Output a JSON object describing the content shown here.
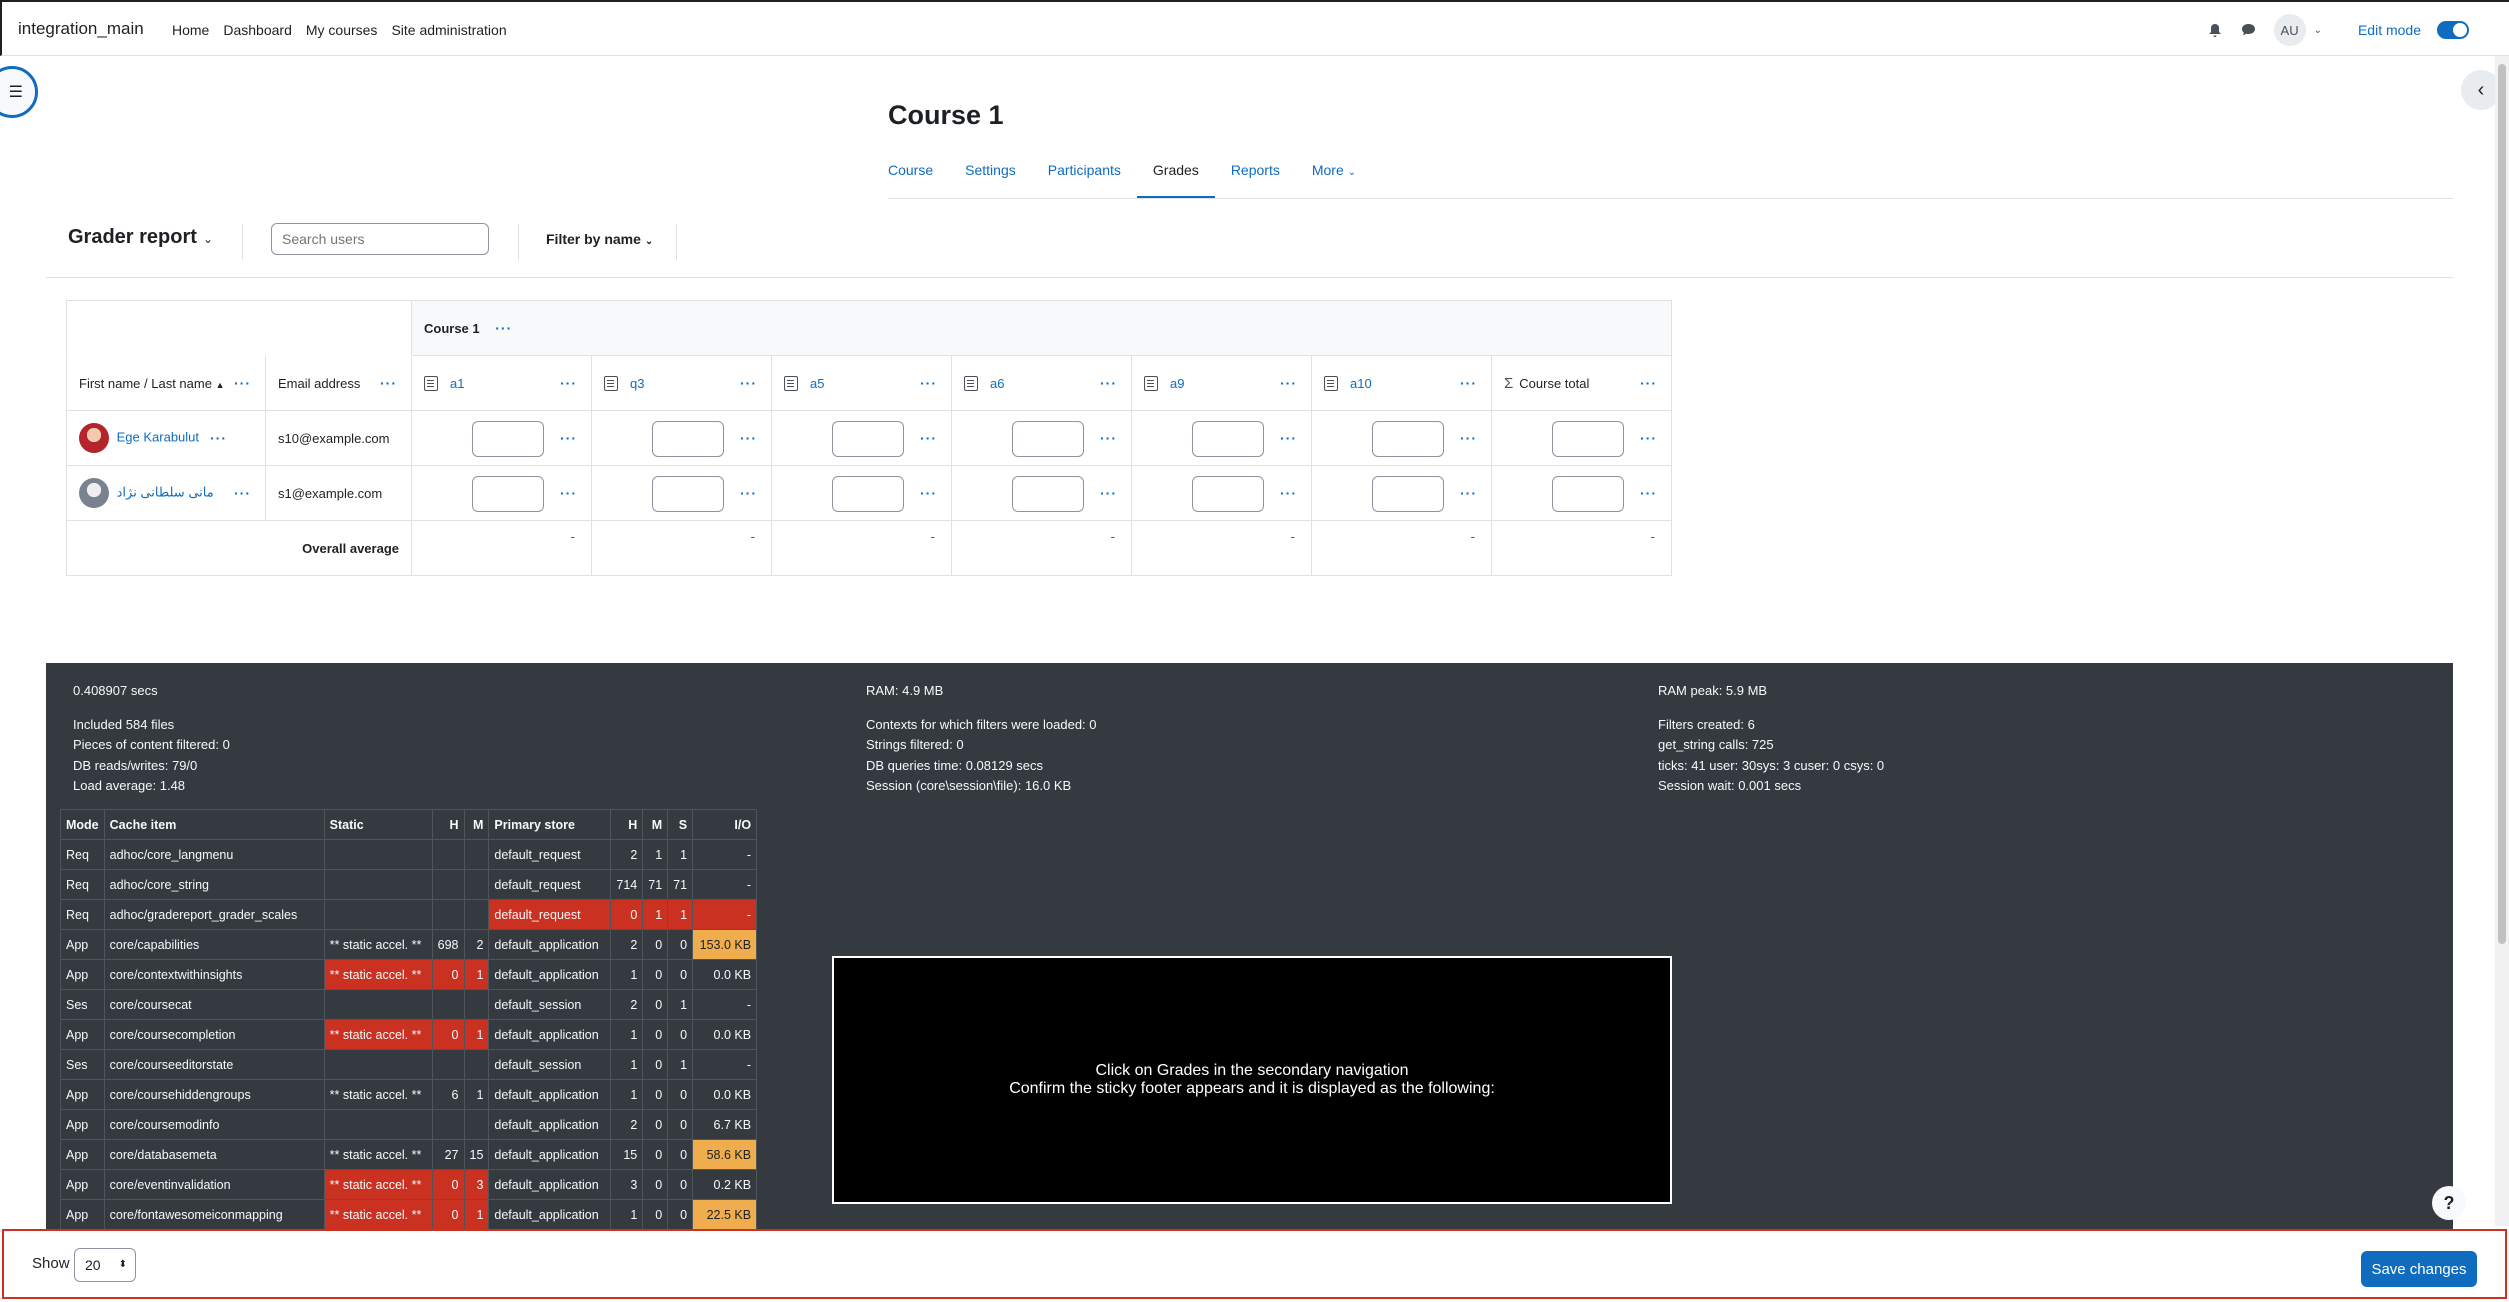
{
  "navbar": {
    "site_name": "integration_main",
    "links": [
      "Home",
      "Dashboard",
      "My courses",
      "Site administration"
    ],
    "user_initials": "AU",
    "edit_mode_label": "Edit mode"
  },
  "course": {
    "title": "Course 1",
    "tabs": [
      "Course",
      "Settings",
      "Participants",
      "Grades",
      "Reports",
      "More"
    ],
    "active_tab": "Grades"
  },
  "tertiary": {
    "report_title": "Grader report",
    "search_placeholder": "Search users",
    "filter_label": "Filter by name"
  },
  "grader": {
    "category": "Course 1",
    "name_header": "First name / Last name",
    "email_header": "Email address",
    "items": [
      "a1",
      "q3",
      "a5",
      "a6",
      "a9",
      "a10"
    ],
    "total_header": "Course total",
    "users": [
      {
        "name": "Ege Karabulut",
        "email": "s10@example.com"
      },
      {
        "name": "مانی سلطانی نژاد",
        "email": "s1@example.com"
      }
    ],
    "average_label": "Overall average",
    "average_values": [
      "-",
      "-",
      "-",
      "-",
      "-",
      "-",
      "-"
    ]
  },
  "perf": {
    "col1": [
      "0.408907 secs",
      "Included 584 files",
      "Pieces of content filtered: 0",
      "DB reads/writes: 79/0",
      "Load average: 1.48"
    ],
    "col2": [
      "RAM: 4.9 MB",
      "Contexts for which filters were loaded: 0",
      "Strings filtered: 0",
      "DB queries time: 0.08129 secs",
      "Session (core\\session\\file): 16.0 KB"
    ],
    "col3": [
      "RAM peak: 5.9 MB",
      "Filters created: 6",
      "get_string calls: 725",
      "ticks: 41 user: 30sys: 3 cuser: 0 csys: 0",
      "Session wait: 0.001 secs"
    ],
    "headers": [
      "Mode",
      "Cache item",
      "Static",
      "H",
      "M",
      "Primary store",
      "H",
      "M",
      "S",
      "I/O"
    ],
    "rows": [
      [
        "Req",
        "adhoc/core_langmenu",
        "",
        "",
        "",
        "default_request",
        "2",
        "1",
        "1",
        "-"
      ],
      [
        "Req",
        "adhoc/core_string",
        "",
        "",
        "",
        "default_request",
        "714",
        "71",
        "71",
        "-"
      ],
      [
        "Req",
        "adhoc/gradereport_grader_scales",
        "",
        "",
        "",
        "default_request",
        "0",
        "1",
        "1",
        "-"
      ],
      [
        "App",
        "core/capabilities",
        "** static accel. **",
        "698",
        "2",
        "default_application",
        "2",
        "0",
        "0",
        "153.0 KB"
      ],
      [
        "App",
        "core/contextwithinsights",
        "** static accel. **",
        "0",
        "1",
        "default_application",
        "1",
        "0",
        "0",
        "0.0 KB"
      ],
      [
        "Ses",
        "core/coursecat",
        "",
        "",
        "",
        "default_session",
        "2",
        "0",
        "1",
        "-"
      ],
      [
        "App",
        "core/coursecompletion",
        "** static accel. **",
        "0",
        "1",
        "default_application",
        "1",
        "0",
        "0",
        "0.0 KB"
      ],
      [
        "Ses",
        "core/courseeditorstate",
        "",
        "",
        "",
        "default_session",
        "1",
        "0",
        "1",
        "-"
      ],
      [
        "App",
        "core/coursehiddengroups",
        "** static accel. **",
        "6",
        "1",
        "default_application",
        "1",
        "0",
        "0",
        "0.0 KB"
      ],
      [
        "App",
        "core/coursemodinfo",
        "",
        "",
        "",
        "default_application",
        "2",
        "0",
        "0",
        "6.7 KB"
      ],
      [
        "App",
        "core/databasemeta",
        "** static accel. **",
        "27",
        "15",
        "default_application",
        "15",
        "0",
        "0",
        "58.6 KB"
      ],
      [
        "App",
        "core/eventinvalidation",
        "** static accel. **",
        "0",
        "3",
        "default_application",
        "3",
        "0",
        "0",
        "0.2 KB"
      ],
      [
        "App",
        "core/fontawesomeiconmapping",
        "** static accel. **",
        "0",
        "1",
        "default_application",
        "1",
        "0",
        "0",
        "22.5 KB"
      ]
    ]
  },
  "video": {
    "line1": "Click on Grades in the secondary navigation",
    "line2": "Confirm the sticky footer appears and it is displayed as the following:"
  },
  "footer": {
    "show_label": "Show",
    "per_page": "20",
    "save_label": "Save changes"
  },
  "colors": {
    "accent": "#0f6cbf",
    "footer_bg": "#343a40",
    "danger": "#ca3120",
    "warning": "#f0ad4e"
  }
}
